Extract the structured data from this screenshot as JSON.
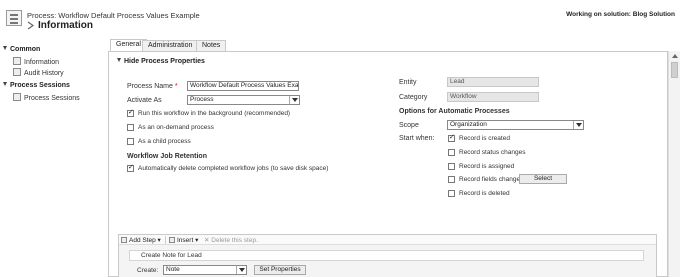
{
  "header": {
    "subtitle": "Process: Workflow Default Process Values Example",
    "title": "Information",
    "solution": "Working on solution: Blog Solution"
  },
  "nav": {
    "groups": [
      {
        "label": "Common",
        "items": [
          "Information",
          "Audit History"
        ]
      },
      {
        "label": "Process Sessions",
        "items": [
          "Process Sessions"
        ]
      }
    ]
  },
  "tabs": [
    "General",
    "Administration",
    "Notes"
  ],
  "form": {
    "section_title": "Hide Process Properties",
    "process_name_label": "Process Name",
    "process_name_required": "*",
    "process_name_value": "Workflow Default Process Values Examp",
    "activate_as_label": "Activate As",
    "activate_as_value": "Process",
    "run_background_label": "Run this workflow in the background (recommended)",
    "run_background_checked": true,
    "on_demand_label": "As an on-demand process",
    "on_demand_checked": false,
    "child_process_label": "As a child process",
    "child_process_checked": false,
    "retention_heading": "Workflow Job Retention",
    "auto_delete_label": "Automatically delete completed workflow jobs (to save disk space)",
    "auto_delete_checked": true,
    "entity_label": "Entity",
    "entity_value": "Lead",
    "category_label": "Category",
    "category_value": "Workflow",
    "options_heading": "Options for Automatic Processes",
    "scope_label": "Scope",
    "scope_value": "Organization",
    "start_when_label": "Start when:",
    "triggers": [
      {
        "label": "Record is created",
        "checked": true
      },
      {
        "label": "Record status changes",
        "checked": false
      },
      {
        "label": "Record is assigned",
        "checked": false
      },
      {
        "label": "Record fields change",
        "checked": false
      },
      {
        "label": "Record is deleted",
        "checked": false
      }
    ],
    "select_button": "Select"
  },
  "steps": {
    "toolbar": {
      "add_step": "Add Step",
      "insert": "Insert",
      "delete": "Delete this step."
    },
    "step_description": "Create Note for Lead",
    "create_label": "Create:",
    "create_value": "Note",
    "set_properties": "Set Properties"
  }
}
